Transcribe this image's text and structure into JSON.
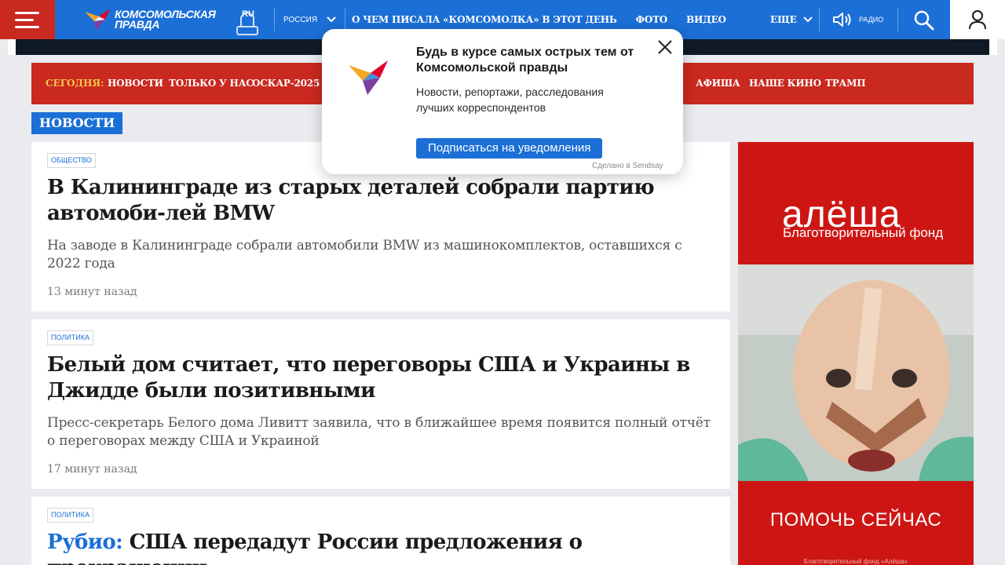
{
  "header": {
    "logo_line1": "КОМСОМОЛЬСКАЯ",
    "logo_line2": "ПРАВДА",
    "logo_badge": "RU",
    "region": "РОССИЯ",
    "nav": [
      "О ЧЕМ ПИСАЛА «КОМСОМОЛКА» В ЭТОТ ДЕНЬ",
      "ФОТО",
      "ВИДЕО"
    ],
    "more_label": "ЕЩЕ",
    "radio_label": "РАДИО"
  },
  "redbar": {
    "today_label": "СЕГОДНЯ:",
    "items": [
      "НОВОСТИ",
      "ТОЛЬКО У НАС",
      "ОСКАР-2025",
      "АФИША",
      "НАШЕ КИНО",
      "ТРАМП"
    ]
  },
  "section_label": "НОВОСТИ",
  "articles": [
    {
      "tag": "ОБЩЕСТВО",
      "title": "В Калининграде из старых деталей собрали партию автомоби-лей BMW",
      "lead": "На заводе в Калининграде собрали автомобили BMW из машинокомплектов, оставшихся с 2022 года",
      "time": "13 минут назад"
    },
    {
      "tag": "ПОЛИТИКА",
      "title": "Белый дом считает, что переговоры США и Украины в Джидде были позитивными",
      "lead": "Пресс-секретарь Белого дома Ливитт заявила, что в ближайшее время появится полный отчёт о переговорах между США и Украиной",
      "time": "17 минут назад"
    },
    {
      "tag": "ПОЛИТИКА",
      "title_accent": "Рубио:",
      "title": "США передадут России предложения о прекращении"
    }
  ],
  "ad": {
    "brand": "алёша",
    "brand_sub": "Благотворительный фонд",
    "cta": "ПОМОЧЬ СЕЙЧАС",
    "footer": "Благотворительный фонд «Алёша»",
    "color": "#cd1613"
  },
  "popup": {
    "title": "Будь в курсе самых острых тем от Комсомольской правды",
    "text": "Новости, репортажи, расследования лучших корреспондентов",
    "button": "Подписаться на уведомления",
    "credit": "Сделано в Sendsay"
  },
  "colors": {
    "brand_blue": "#1b6fd6",
    "brand_red": "#c9291f",
    "today_yellow": "#f5c84c"
  }
}
